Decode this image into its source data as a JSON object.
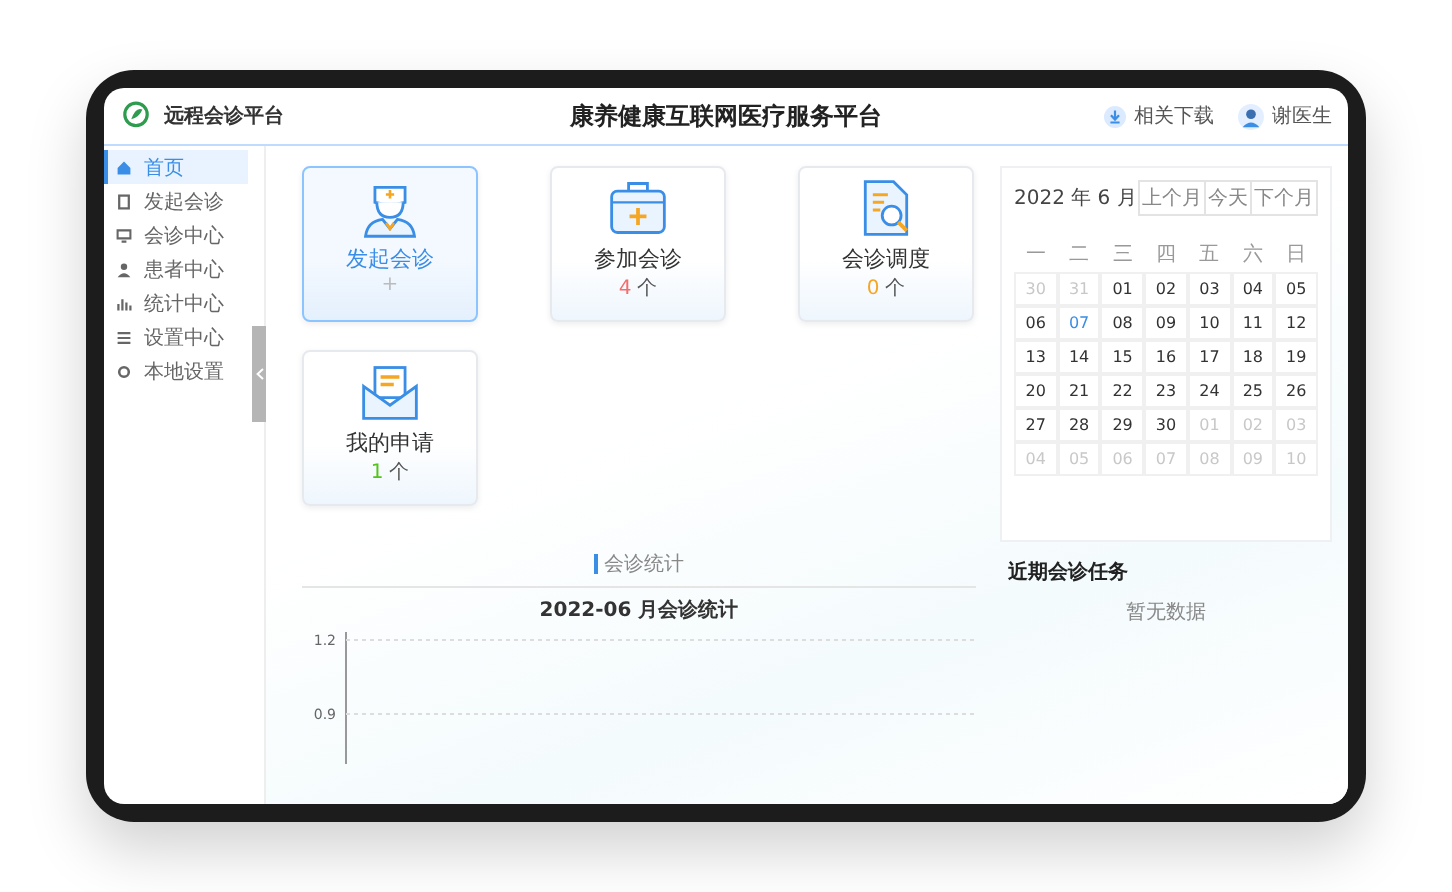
{
  "header": {
    "app_name": "远程会诊平台",
    "title": "康养健康互联网医疗服务平台",
    "download_link": "相关下载",
    "user_name": "谢医生"
  },
  "sidebar": {
    "items": [
      {
        "label": "首页",
        "kind": "link",
        "selected": true
      },
      {
        "label": "发起会诊",
        "kind": "link",
        "selected": false
      },
      {
        "label": "会诊中心",
        "kind": "group",
        "selected": false
      },
      {
        "label": "患者中心",
        "kind": "link",
        "selected": false
      },
      {
        "label": "统计中心",
        "kind": "link",
        "selected": false
      },
      {
        "label": "设置中心",
        "kind": "link",
        "selected": false
      },
      {
        "label": "本地设置",
        "kind": "link",
        "selected": false
      }
    ]
  },
  "cards": [
    {
      "title": "发起会诊",
      "kind": "doctor",
      "count": "+",
      "selected": true,
      "color": "#bbbbbb"
    },
    {
      "title": "参加会诊",
      "kind": "kit",
      "count": "4",
      "unit": "个",
      "selected": false,
      "color": "#f56c6c"
    },
    {
      "title": "会诊调度",
      "kind": "document",
      "count": "0",
      "unit": "个",
      "selected": false,
      "color": "#f5a623"
    },
    {
      "title": "我的申请",
      "kind": "envelope",
      "count": "1",
      "unit": "个",
      "selected": false,
      "color": "#52c41a"
    }
  ],
  "stats": {
    "section_title": "会诊统计",
    "chart_title": "2022-06 月会诊统计",
    "axis_labels": [
      "1.2",
      "0.9"
    ]
  },
  "calendar": {
    "title": "2022 年 6 月",
    "buttons": [
      "上个月",
      "今天",
      "下个月"
    ],
    "weekdays": [
      "一",
      "二",
      "三",
      "四",
      "五",
      "六",
      "日"
    ],
    "weeks": [
      [
        {
          "day": "30",
          "muted": true,
          "selected": false
        },
        {
          "day": "31",
          "muted": true,
          "selected": false
        },
        {
          "day": "01",
          "muted": false,
          "selected": false
        },
        {
          "day": "02",
          "muted": false,
          "selected": false
        },
        {
          "day": "03",
          "muted": false,
          "selected": false
        },
        {
          "day": "04",
          "muted": false,
          "selected": false
        },
        {
          "day": "05",
          "muted": false,
          "selected": false
        }
      ],
      [
        {
          "day": "06",
          "muted": false,
          "selected": false
        },
        {
          "day": "07",
          "muted": false,
          "selected": true
        },
        {
          "day": "08",
          "muted": false,
          "selected": false
        },
        {
          "day": "09",
          "muted": false,
          "selected": false
        },
        {
          "day": "10",
          "muted": false,
          "selected": false
        },
        {
          "day": "11",
          "muted": false,
          "selected": false
        },
        {
          "day": "12",
          "muted": false,
          "selected": false
        }
      ],
      [
        {
          "day": "13",
          "muted": false,
          "selected": false
        },
        {
          "day": "14",
          "muted": false,
          "selected": false
        },
        {
          "day": "15",
          "muted": false,
          "selected": false
        },
        {
          "day": "16",
          "muted": false,
          "selected": false
        },
        {
          "day": "17",
          "muted": false,
          "selected": false
        },
        {
          "day": "18",
          "muted": false,
          "selected": false
        },
        {
          "day": "19",
          "muted": false,
          "selected": false
        }
      ],
      [
        {
          "day": "20",
          "muted": false,
          "selected": false
        },
        {
          "day": "21",
          "muted": false,
          "selected": false
        },
        {
          "day": "22",
          "muted": false,
          "selected": false
        },
        {
          "day": "23",
          "muted": false,
          "selected": false
        },
        {
          "day": "24",
          "muted": false,
          "selected": false
        },
        {
          "day": "25",
          "muted": false,
          "selected": false
        },
        {
          "day": "26",
          "muted": false,
          "selected": false
        }
      ],
      [
        {
          "day": "27",
          "muted": false,
          "selected": false
        },
        {
          "day": "28",
          "muted": false,
          "selected": false
        },
        {
          "day": "29",
          "muted": false,
          "selected": false
        },
        {
          "day": "30",
          "muted": false,
          "selected": false
        },
        {
          "day": "01",
          "muted": true,
          "selected": false
        },
        {
          "day": "02",
          "muted": true,
          "selected": false
        },
        {
          "day": "03",
          "muted": true,
          "selected": false
        }
      ],
      [
        {
          "day": "04",
          "muted": true,
          "selected": false
        },
        {
          "day": "05",
          "muted": true,
          "selected": false
        },
        {
          "day": "06",
          "muted": true,
          "selected": false
        },
        {
          "day": "07",
          "muted": true,
          "selected": false
        },
        {
          "day": "08",
          "muted": true,
          "selected": false
        },
        {
          "day": "09",
          "muted": true,
          "selected": false
        },
        {
          "day": "10",
          "muted": true,
          "selected": false
        }
      ]
    ]
  },
  "tasks": {
    "title": "近期会诊任务",
    "empty_text": "暂无数据"
  }
}
